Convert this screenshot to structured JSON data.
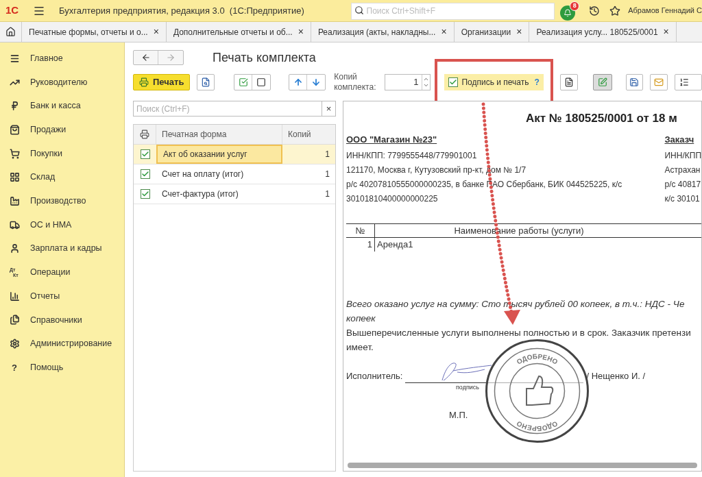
{
  "app_bar": {
    "logo": "1С",
    "title": "Бухгалтерия предприятия, редакция 3.0  (1С:Предприятие)",
    "search": {
      "placeholder": "Поиск Ctrl+Shift+F"
    },
    "notifications": "8",
    "user": "Абрамов Геннадий С"
  },
  "tabs": [
    {
      "label": "Печатные формы, отчеты и о...",
      "close": "×"
    },
    {
      "label": "Дополнительные отчеты и об...",
      "close": "×"
    },
    {
      "label": "Реализация (акты, накладны...",
      "close": "×"
    },
    {
      "label": "Организации",
      "close": "×"
    },
    {
      "label": "Реализация услу... 180525/0001",
      "close": "×"
    }
  ],
  "sidebar": {
    "items": [
      {
        "label": "Главное"
      },
      {
        "label": "Руководителю"
      },
      {
        "label": "Банк и касса"
      },
      {
        "label": "Продажи"
      },
      {
        "label": "Покупки"
      },
      {
        "label": "Склад"
      },
      {
        "label": "Производство"
      },
      {
        "label": "ОС и НМА"
      },
      {
        "label": "Зарплата и кадры"
      },
      {
        "label": "Операции",
        "glyph": [
          "Дт",
          "Кт"
        ]
      },
      {
        "label": "Отчеты"
      },
      {
        "label": "Справочники"
      },
      {
        "label": "Администрирование"
      },
      {
        "label": "Помощь",
        "glyph": [
          "?"
        ]
      }
    ]
  },
  "form": {
    "title": "Печать комплекта",
    "print_button": "Печать",
    "copies_label": "Копий комплекта:",
    "copies_value": "1",
    "sign_checkbox": {
      "label": "Подпись и печать",
      "checked": true,
      "help": "?"
    },
    "search": {
      "placeholder": "Поиск (Ctrl+F)",
      "clear": "×"
    },
    "table": {
      "columns": [
        "Печатная форма",
        "Копий"
      ],
      "rows": [
        {
          "checked": true,
          "name": "Акт об оказании услуг",
          "copies": "1",
          "selected": true
        },
        {
          "checked": true,
          "name": "Счет на оплату (итог)",
          "copies": "1",
          "selected": false
        },
        {
          "checked": true,
          "name": "Счет-фактура (итог)",
          "copies": "1",
          "selected": false
        }
      ]
    }
  },
  "document": {
    "title": "Акт № 180525/0001 от 18 м",
    "seller": {
      "name": "ООО \"Магазин №23\"",
      "lines": [
        "ИНН/КПП: 7799555448/779901001",
        "121170, Москва г, Кутузовский пр-кт, дом № 1/7",
        "р/с 40207810555000000235, в банке ПАО Сбербанк, БИК 044525225, к/с",
        "30101810400000000225"
      ]
    },
    "buyer": {
      "name": "Заказч",
      "lines": [
        "ИНН/КПП",
        "Астрахан",
        "р/с 40817",
        "к/с 30101"
      ]
    },
    "table": {
      "columns": [
        "№",
        "Наименование работы (услуги)"
      ],
      "rows": [
        {
          "num": "1",
          "name": "Аренда1"
        }
      ]
    },
    "total_lines": [
      "Всего оказано услуг на сумму: Сто тысяч рублей 00 копеек, в т.ч.: НДС - Че",
      "копеек"
    ],
    "statement_lines": [
      "Вышеперечисленные услуги выполнены полностью и в срок. Заказчик претензи",
      "имеет."
    ],
    "signer_label": "Исполнитель:",
    "signer_name": "/ Нещенко И. /",
    "signature_caption": "подпись",
    "seal_mark": "М.П.",
    "stamp_texts": [
      "ОДОБРЕНО",
      "ОДОБРЕНО"
    ]
  }
}
